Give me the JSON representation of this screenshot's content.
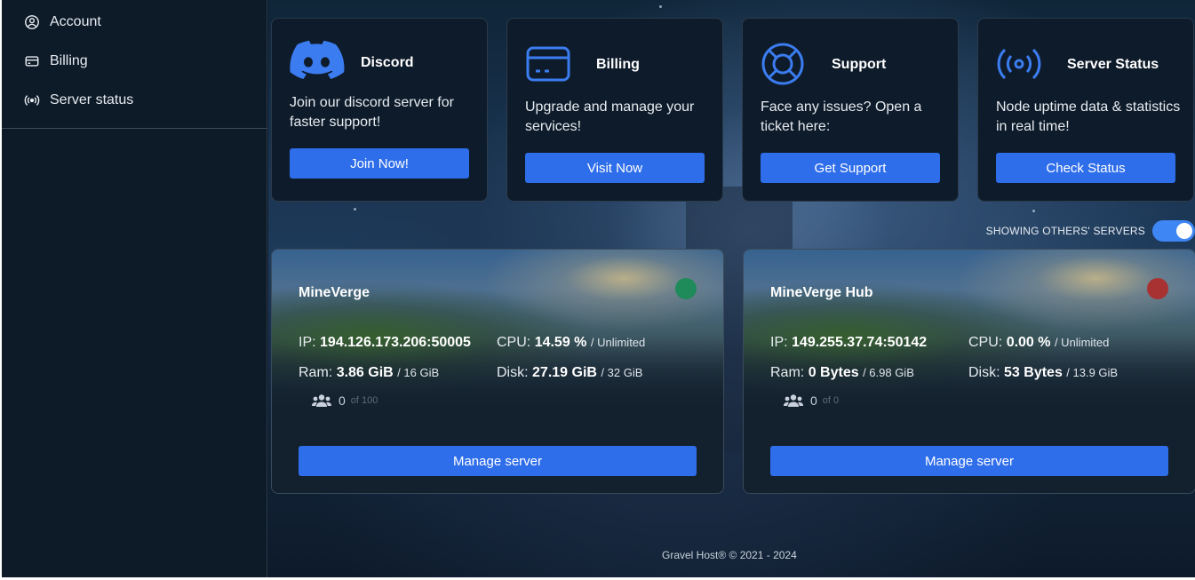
{
  "sidebar": {
    "items": [
      {
        "label": "Account",
        "icon": "user-circle-icon"
      },
      {
        "label": "Billing",
        "icon": "credit-card-icon"
      },
      {
        "label": "Server status",
        "icon": "broadcast-icon"
      }
    ]
  },
  "cards": [
    {
      "title": "Discord",
      "description": "Join our discord server for faster support!",
      "button": "Join Now!",
      "icon": "discord-icon"
    },
    {
      "title": "Billing",
      "description": "Upgrade and manage your services!",
      "button": "Visit Now",
      "icon": "credit-card-icon"
    },
    {
      "title": "Support",
      "description": "Face any issues? Open a ticket here:",
      "button": "Get Support",
      "icon": "lifebuoy-icon"
    },
    {
      "title": "Server Status",
      "description": "Node uptime data & statistics in real time!",
      "button": "Check Status",
      "icon": "broadcast-icon"
    }
  ],
  "toggle": {
    "label": "SHOWING OTHERS' SERVERS",
    "on": true
  },
  "servers": [
    {
      "name": "MineVerge",
      "status": "online",
      "status_color": "#1f8a5a",
      "ip_label": "IP:",
      "ip": "194.126.173.206:50005",
      "cpu_label": "CPU:",
      "cpu": "14.59 %",
      "cpu_limit": "/ Unlimited",
      "ram_label": "Ram:",
      "ram": "3.86 GiB",
      "ram_limit": "/ 16 GiB",
      "disk_label": "Disk:",
      "disk": "27.19 GiB",
      "disk_limit": "/ 32 GiB",
      "players": "0",
      "players_of": "of 100",
      "button": "Manage server"
    },
    {
      "name": "MineVerge Hub",
      "status": "offline",
      "status_color": "#a83232",
      "ip_label": "IP:",
      "ip": "149.255.37.74:50142",
      "cpu_label": "CPU:",
      "cpu": "0.00 %",
      "cpu_limit": "/ Unlimited",
      "ram_label": "Ram:",
      "ram": "0 Bytes",
      "ram_limit": "/ 6.98 GiB",
      "disk_label": "Disk:",
      "disk": "53 Bytes",
      "disk_limit": "/ 13.9 GiB",
      "players": "0",
      "players_of": "of 0",
      "button": "Manage server"
    }
  ],
  "footer": "Gravel Host® © 2021 - 2024",
  "colors": {
    "accent": "#2f6eea",
    "icon_blue": "#3b7cf0",
    "panel": "#0e1b2a"
  }
}
